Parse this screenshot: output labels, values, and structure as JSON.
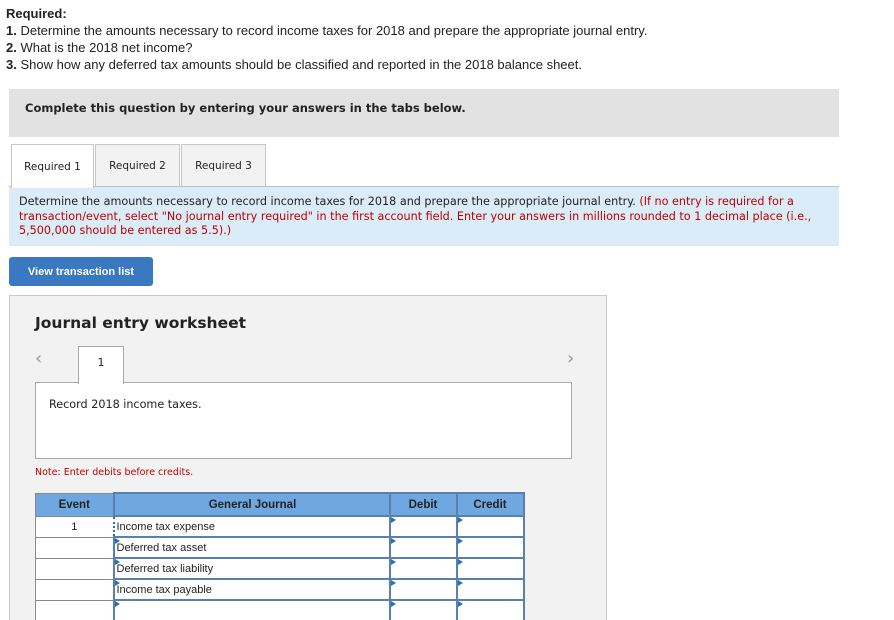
{
  "required": {
    "title": "Required:",
    "items": [
      {
        "num": "1.",
        "text": " Determine the amounts necessary to record income taxes for 2018 and prepare the appropriate journal entry."
      },
      {
        "num": "2.",
        "text": " What is the 2018 net income?"
      },
      {
        "num": "3.",
        "text": " Show how any deferred tax amounts should be classified and reported in the 2018 balance sheet."
      }
    ]
  },
  "banner": "Complete this question by entering your answers in the tabs below.",
  "tabs": [
    {
      "label": "Required 1",
      "active": true
    },
    {
      "label": "Required 2",
      "active": false
    },
    {
      "label": "Required 3",
      "active": false
    }
  ],
  "instructions": {
    "main": "Determine the amounts necessary to record income taxes for 2018 and prepare the appropriate journal entry. ",
    "note": "(If no entry is required for a transaction/event, select \"No journal entry required\" in the first account field. Enter your answers in millions rounded to 1 decimal place (i.e., 5,500,000 should be entered as 5.5).)"
  },
  "view_transaction_button": "View transaction list",
  "worksheet": {
    "title": "Journal entry worksheet",
    "prev_icon": "‹",
    "next_icon": "›",
    "entry_tab": "1",
    "entry_description": "Record 2018 income taxes.",
    "note": "Note: Enter debits before credits.",
    "table": {
      "headers": {
        "event": "Event",
        "account": "General Journal",
        "debit": "Debit",
        "credit": "Credit"
      },
      "rows": [
        {
          "event": "1",
          "account": "Income tax expense",
          "debit": "",
          "credit": ""
        },
        {
          "event": "",
          "account": "Deferred tax asset",
          "debit": "",
          "credit": ""
        },
        {
          "event": "",
          "account": "Deferred tax liability",
          "debit": "",
          "credit": ""
        },
        {
          "event": "",
          "account": "Income tax payable",
          "debit": "",
          "credit": ""
        },
        {
          "event": "",
          "account": "",
          "debit": "",
          "credit": ""
        }
      ]
    }
  }
}
